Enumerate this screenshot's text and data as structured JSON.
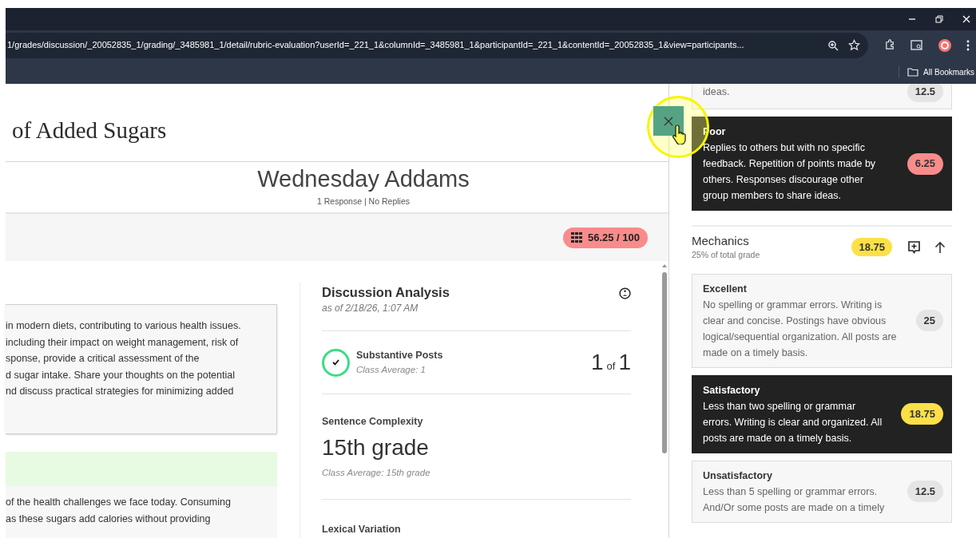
{
  "browser": {
    "url": "1/grades/discussion/_20052835_1/grading/_3485981_1/detail/rubric-evaluation?userId=_221_1&columnId=_3485981_1&participantId=_221_1&contentId=_20052835_1&view=participants...",
    "bookmarks_label": "All Bookmarks"
  },
  "page": {
    "title": "of Added Sugars",
    "student": {
      "name": "Wednesday Addams",
      "stats": "1 Response | No Replies"
    },
    "grade": "56.25 / 100",
    "prompt_lines": [
      "in modern diets, contributing to various health issues.",
      "including their impact on weight management, risk of",
      "sponse, provide a critical assessment of the",
      "d sugar intake. Share your thoughts on the potential",
      "nd discuss practical strategies for minimizing added"
    ],
    "response_lines": [
      "of the health challenges we face today. Consuming",
      "as these sugars add calories without providing"
    ],
    "analysis": {
      "title": "Discussion Analysis",
      "as_of": "as of 2/18/26, 1:07 AM",
      "substantive": {
        "label": "Substantive Posts",
        "average": "Class Average: 1",
        "met": true,
        "count": "1",
        "of": "of",
        "total": "1"
      },
      "complexity": {
        "label": "Sentence Complexity",
        "value": "15th grade",
        "average": "Class Average: 15th grade"
      },
      "lexical": {
        "label": "Lexical Variation"
      }
    }
  },
  "rubric": [
    {
      "kind": "level",
      "description": "ideas.",
      "points": "12.5",
      "selected": false,
      "color": "#e5e5e5"
    },
    {
      "kind": "level",
      "title": "Poor",
      "description": "Replies to others but with no specific feedback. Repetition of points made by others. Responses discourage other group members to share ideas.",
      "points": "6.25",
      "selected": true,
      "color": "#f98b8b"
    },
    {
      "kind": "criterion",
      "name": "Mechanics",
      "weight": "25% of total grade",
      "score": "18.75",
      "color": "#fde047"
    },
    {
      "kind": "level",
      "title": "Excellent",
      "description": "No spelling or grammar errors. Writing is clear and concise. Postings have obvious logical/sequential organization. All posts are made on a timely basis.",
      "points": "25",
      "selected": false,
      "color": "#e5e5e5"
    },
    {
      "kind": "level",
      "title": "Satisfactory",
      "description": "Less than two spelling or grammar errors. Writing is clear and organized. All posts are made on a timely basis.",
      "points": "18.75",
      "selected": true,
      "color": "#fde047"
    },
    {
      "kind": "level",
      "title": "Unsatisfactory",
      "description": "Less than 5 spelling or grammar errors. And/Or some posts are made on a timely",
      "points": "12.5",
      "selected": false,
      "color": "#e5e5e5"
    }
  ]
}
